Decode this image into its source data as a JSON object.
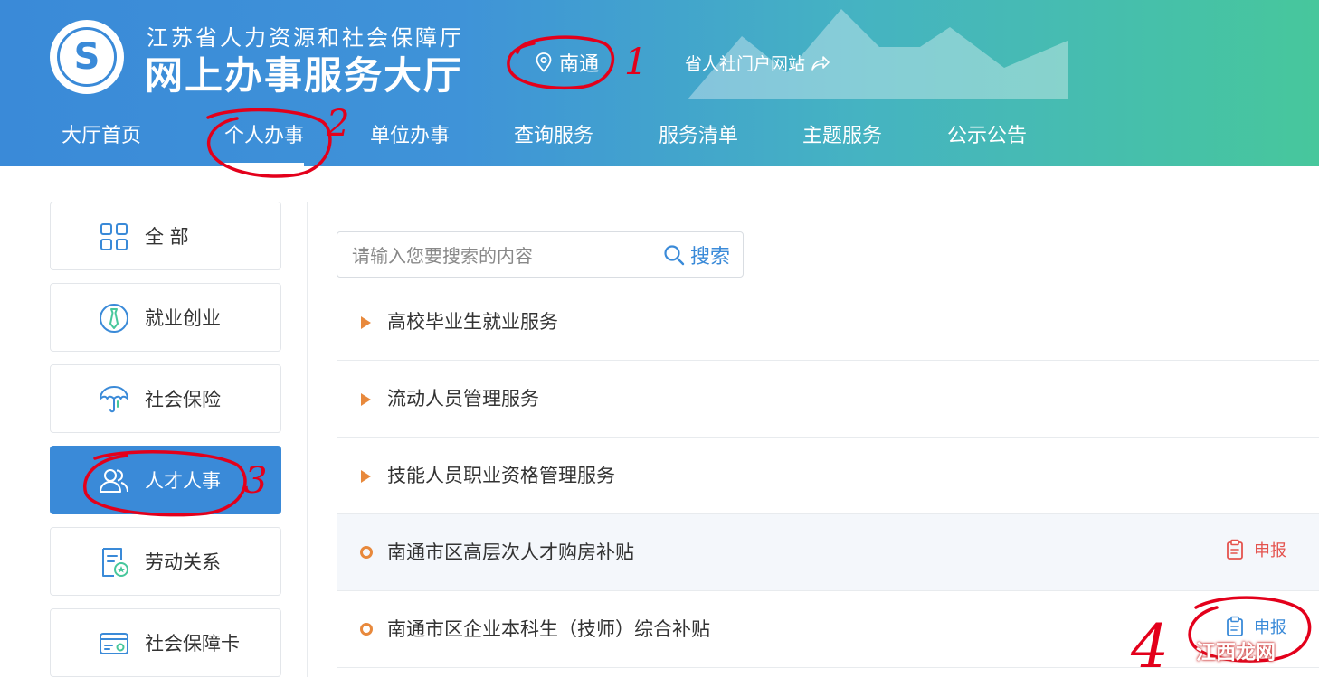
{
  "header": {
    "org_subtitle": "江苏省人力资源和社会保障厅",
    "hall_title": "网上办事服务大厅",
    "city": "南通",
    "portal_link": "省人社门户网站"
  },
  "nav": {
    "items": [
      "大厅首页",
      "个人办事",
      "单位办事",
      "查询服务",
      "服务清单",
      "主题服务",
      "公示公告"
    ],
    "active_index": 1
  },
  "sidebar": {
    "items": [
      {
        "label": "全 部",
        "icon": "grid-icon"
      },
      {
        "label": "就业创业",
        "icon": "tie-icon"
      },
      {
        "label": "社会保险",
        "icon": "umbrella-icon"
      },
      {
        "label": "人才人事",
        "icon": "people-icon"
      },
      {
        "label": "劳动关系",
        "icon": "document-badge-icon"
      },
      {
        "label": "社会保障卡",
        "icon": "card-icon"
      }
    ],
    "active_index": 3
  },
  "search": {
    "placeholder": "请输入您要搜索的内容",
    "button_label": "搜索"
  },
  "list": {
    "items": [
      {
        "label": "高校毕业生就业服务",
        "kind": "category"
      },
      {
        "label": "流动人员管理服务",
        "kind": "category"
      },
      {
        "label": "技能人员职业资格管理服务",
        "kind": "category"
      },
      {
        "label": "南通市区高层次人才购房补贴",
        "kind": "service",
        "action": "申报"
      },
      {
        "label": "南通市区企业本科生（技师）综合补贴",
        "kind": "service",
        "action": "申报"
      }
    ]
  },
  "annotations": [
    "1",
    "2",
    "3",
    "4"
  ],
  "watermark": "江西龙网",
  "colors": {
    "primary": "#3a8ad8",
    "accent_green": "#47c79c",
    "bullet": "#e8893c",
    "apply_red": "#e4534e",
    "annotation_red": "#e3001b"
  }
}
